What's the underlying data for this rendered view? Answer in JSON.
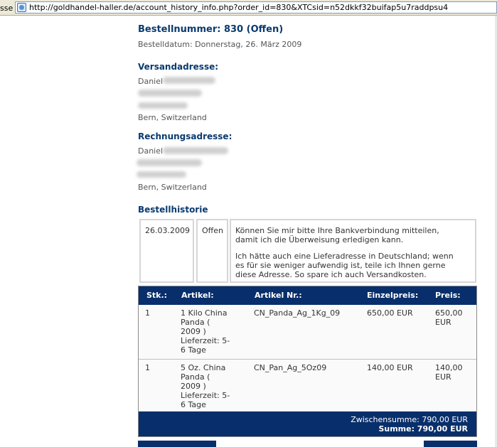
{
  "browser": {
    "address_label": "sse",
    "url": "http://goldhandel-haller.de/account_history_info.php?order_id=830&XTCsid=n52dkkf32buifap5u7raddpsu4"
  },
  "order": {
    "title": "Bestellnummer: 830 (Offen)",
    "date": "Bestelldatum: Donnerstag, 26. März 2009"
  },
  "shipping": {
    "heading": "Versandadresse:",
    "name": "Daniel",
    "city": "Bern, Switzerland"
  },
  "billing": {
    "heading": "Rechnungsadresse:",
    "name": "Daniel",
    "city": "Bern, Switzerland"
  },
  "history": {
    "heading": "Bestellhistorie",
    "date": "26.03.2009",
    "status": "Offen",
    "comment_line1": "Können Sie mir bitte Ihre Bankverbindung mitteilen,",
    "comment_line2": "damit ich die Überweisung erledigen kann.",
    "comment_line3": "Ich hätte auch eine Lieferadresse in Deutschland; wenn",
    "comment_line4": "es für sie weniger aufwendig ist, teile ich Ihnen gerne",
    "comment_line5": "diese Adresse. So spare ich auch Versandkosten."
  },
  "table": {
    "headers": {
      "qty": "Stk.:",
      "article": "Artikel:",
      "artno": "Artikel Nr.:",
      "unit": "Einzelpreis:",
      "price": "Preis:"
    },
    "rows": [
      {
        "qty": "1",
        "article": [
          "1 Kilo China",
          "Panda (",
          "2009 )",
          "Lieferzeit: 5-",
          "6 Tage"
        ],
        "artno": "CN_Panda_Ag_1Kg_09",
        "unit": "650,00 EUR",
        "price": [
          "650,00",
          "EUR"
        ]
      },
      {
        "qty": "1",
        "article": [
          "5 Oz. China",
          "Panda (",
          "2009 )",
          "Lieferzeit: 5-",
          "6 Tage"
        ],
        "artno": "CN_Pan_Ag_5Oz09",
        "unit": "140,00 EUR",
        "price": [
          "140,00",
          "EUR"
        ]
      }
    ],
    "subtotal": "Zwischensumme: 790,00 EUR",
    "total": "Summe: 790,00 EUR"
  }
}
